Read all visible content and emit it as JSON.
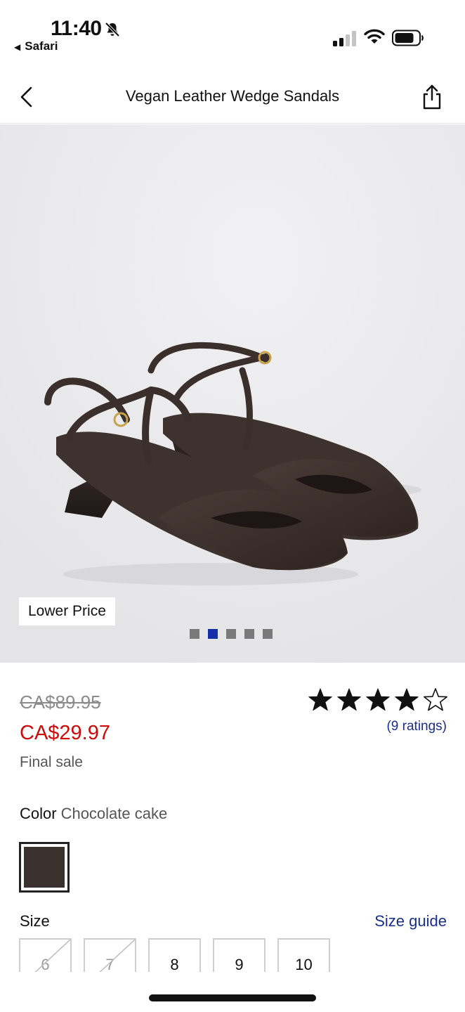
{
  "status_bar": {
    "time": "11:40",
    "back_app": "Safari",
    "bell_icon": "bell-slash-icon",
    "signal_icon": "cellular-signal-icon",
    "wifi_icon": "wifi-icon",
    "battery_icon": "battery-icon"
  },
  "nav": {
    "back_icon": "chevron-left-icon",
    "title": "Vegan Leather Wedge Sandals",
    "share_icon": "share-icon"
  },
  "gallery": {
    "badge": "Lower Price",
    "image_count": 5,
    "active_index": 1,
    "colors": {
      "active_dot": "#1330a8",
      "dot": "#7a7a7a"
    }
  },
  "product": {
    "original_price": "CA$89.95",
    "sale_price": "CA$29.97",
    "sale_note": "Final sale",
    "rating": 4,
    "rating_max": 5,
    "ratings_count": "(9 ratings)",
    "colors": {
      "sale": "#cc0a0a",
      "link": "#1a2f8a"
    }
  },
  "color": {
    "label": "Color",
    "value": "Chocolate cake",
    "swatch": "#3a302d"
  },
  "size": {
    "label": "Size",
    "guide": "Size guide",
    "options": [
      {
        "label": "6",
        "available": false
      },
      {
        "label": "7",
        "available": false
      },
      {
        "label": "8",
        "available": true
      },
      {
        "label": "9",
        "available": true
      },
      {
        "label": "10",
        "available": true
      }
    ]
  }
}
